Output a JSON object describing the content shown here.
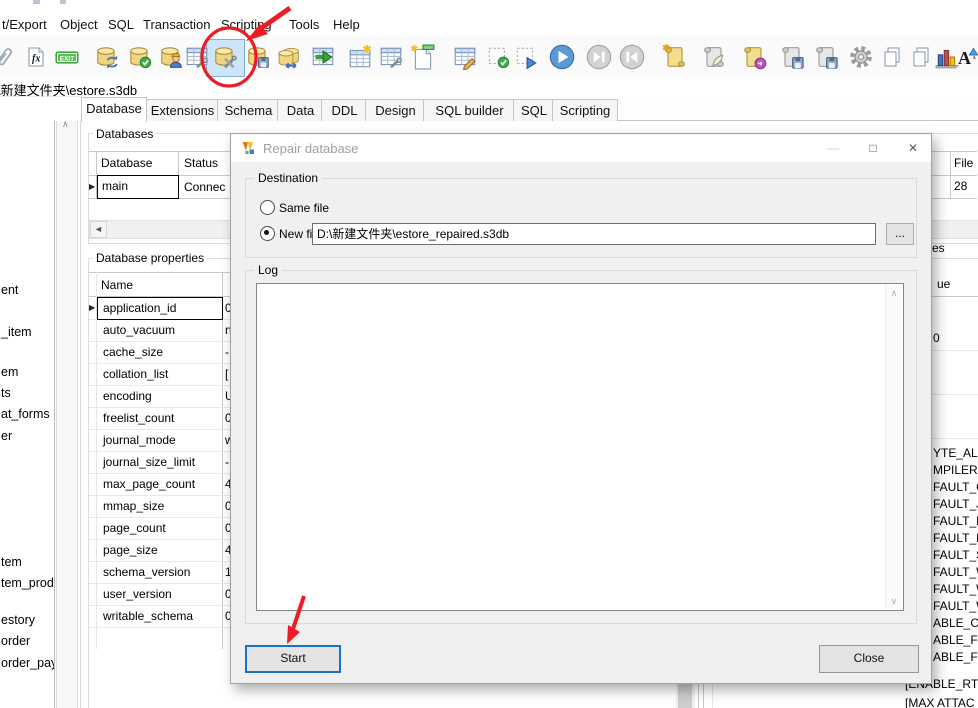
{
  "menu": {
    "items": [
      "t/Export",
      "Object",
      "SQL",
      "Transaction",
      "Scripting",
      "Tools",
      "Help"
    ]
  },
  "pathbar": {
    "text": "\\新建文件夹\\estore.s3db"
  },
  "tabs": {
    "items": [
      "Database",
      "Extensions",
      "Schema",
      "Data",
      "DDL",
      "Design",
      "SQL builder",
      "SQL",
      "Scripting"
    ],
    "active": "Database"
  },
  "databases": {
    "title": "Databases",
    "col_database": "Database",
    "col_status": "Status",
    "col_file": "File",
    "row": {
      "database": "main",
      "status": "Connec",
      "file": "28"
    }
  },
  "properties": {
    "title": "Database properties",
    "col_name": "Name",
    "group_label_fragment": "es",
    "value_header_fragment": "ue",
    "cell_zero_fragment": "0",
    "rows": [
      {
        "name": "application_id",
        "value_fragment": "0"
      },
      {
        "name": "auto_vacuum",
        "value_fragment": "n"
      },
      {
        "name": "cache_size",
        "value_fragment": "-"
      },
      {
        "name": "collation_list",
        "value_fragment": "["
      },
      {
        "name": "encoding",
        "value_fragment": "U"
      },
      {
        "name": "freelist_count",
        "value_fragment": "0"
      },
      {
        "name": "journal_mode",
        "value_fragment": "w"
      },
      {
        "name": "journal_size_limit",
        "value_fragment": "-"
      },
      {
        "name": "max_page_count",
        "value_fragment": "4"
      },
      {
        "name": "mmap_size",
        "value_fragment": "0"
      },
      {
        "name": "page_count",
        "value_fragment": "0"
      },
      {
        "name": "page_size",
        "value_fragment": "4"
      },
      {
        "name": "schema_version",
        "value_fragment": "1"
      },
      {
        "name": "user_version",
        "value_fragment": "0"
      },
      {
        "name": "writable_schema",
        "value_fragment": "0"
      }
    ]
  },
  "tree": {
    "fragments": [
      "ent",
      "_item",
      "em",
      "ts",
      "at_forms",
      "er",
      "tem",
      "tem_prod",
      "estory",
      "order",
      "order_pay"
    ]
  },
  "right_list": {
    "items": [
      "YTE_ALIG",
      "MPILER=",
      "FAULT_CA",
      "FAULT_JO",
      "FAULT_PA",
      "FAULT_RE",
      "FAULT_SY",
      "FAULT_W",
      "FAULT_W",
      "FAULT_W",
      "ABLE_CO",
      "ABLE_FTS",
      "ABLE_FTS"
    ],
    "below_items": [
      "[ENABLE_RT",
      "[MAX ATTAC"
    ]
  },
  "dialog": {
    "title": "Repair database",
    "destination_label": "Destination",
    "radio_same": "Same file",
    "radio_new": "New file:",
    "new_file_path": "D:\\新建文件夹\\estore_repaired.s3db",
    "browse_label": "...",
    "log_label": "Log",
    "start_label": "Start",
    "close_label": "Close"
  },
  "glyphs": {
    "minimize": "—",
    "maximize": "□",
    "close": "✕",
    "up": "∧",
    "down": "∨",
    "left": "◄",
    "row_marker": "▶"
  },
  "colors": {
    "annotation_red": "#ed1c24",
    "focus_blue": "#1a72c8",
    "highlight_blue": "#cde6f7"
  }
}
